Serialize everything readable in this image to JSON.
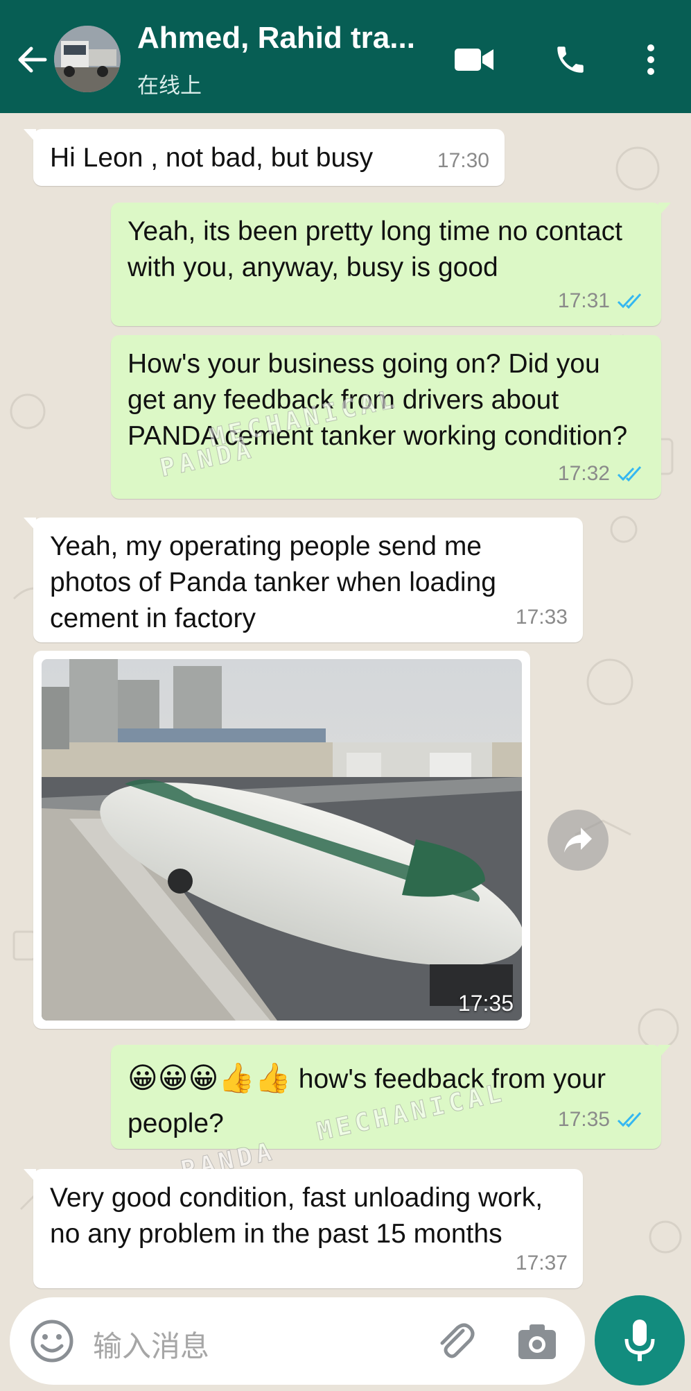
{
  "header": {
    "title": "Ahmed, Rahid tra...",
    "status": "在线上",
    "icons": [
      "back-arrow-icon",
      "video-call-icon",
      "voice-call-icon",
      "more-options-icon"
    ]
  },
  "messages": [
    {
      "direction": "in",
      "text": "Hi Leon , not bad, but busy",
      "time": "17:30"
    },
    {
      "direction": "out",
      "text": "Yeah, its been pretty long time no contact with you, anyway, busy is good",
      "time": "17:31",
      "read": true
    },
    {
      "direction": "out",
      "text": "How's your business going on? Did you get any feedback from drivers about PANDA cement tanker working condition?",
      "time": "17:32",
      "read": true
    },
    {
      "direction": "in",
      "text": "Yeah, my operating people send me photos of Panda tanker when loading cement in factory",
      "time": "17:33"
    },
    {
      "direction": "in",
      "type": "image",
      "time": "17:35"
    },
    {
      "direction": "out",
      "emoji": "😀😀😀👍👍",
      "text": "how's feedback from your people?",
      "time": "17:35",
      "read": true
    },
    {
      "direction": "in",
      "text": "Very good condition, fast unloading work, no any problem in the past 15 months",
      "time": "17:37"
    }
  ],
  "watermark": {
    "line1": "MECHANICAL",
    "line2": "PANDA"
  },
  "composer": {
    "placeholder": "输入消息",
    "icons": [
      "emoji-icon",
      "attach-icon",
      "camera-icon",
      "microphone-icon"
    ]
  },
  "colors": {
    "header": "#075e54",
    "outgoing_bubble": "#dcf8c6",
    "incoming_bubble": "#ffffff",
    "read_ticks": "#34b7f1",
    "mic_button": "#128c7e"
  }
}
